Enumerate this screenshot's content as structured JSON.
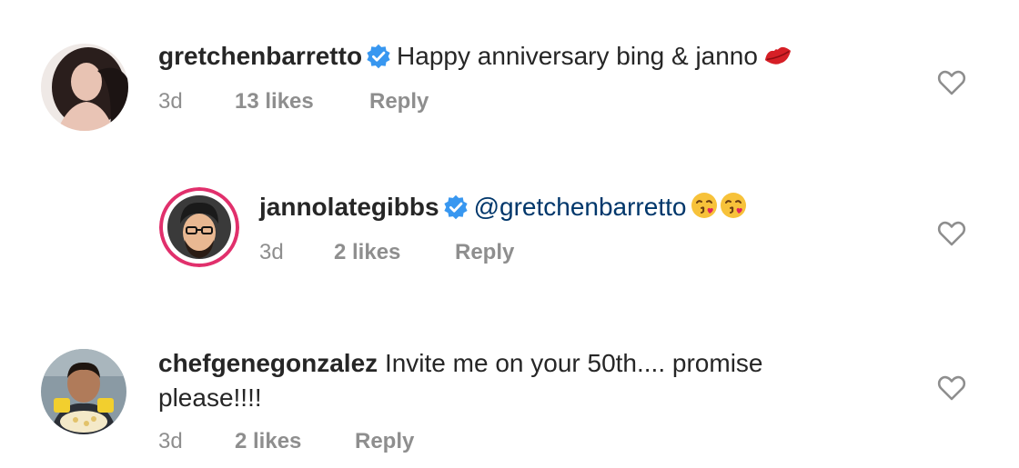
{
  "comments": [
    {
      "username": "gretchenbarretto",
      "verified": true,
      "text": "Happy anniversary bing & janno",
      "emoji": [
        "kiss-mark-icon"
      ],
      "time": "3d",
      "likes": "13 likes",
      "reply": "Reply"
    },
    {
      "username": "jannolategibbs",
      "verified": true,
      "mention": "@gretchenbarretto",
      "emoji": [
        "face-blowing-kiss-icon",
        "face-blowing-kiss-icon"
      ],
      "time": "3d",
      "likes": "2 likes",
      "reply": "Reply",
      "is_reply": true
    },
    {
      "username": "chefgenegonzalez",
      "verified": false,
      "text": "Invite me on your 50th.... promise please!!!!",
      "time": "3d",
      "likes": "2 likes",
      "reply": "Reply"
    }
  ],
  "colors": {
    "text": "#262626",
    "muted": "#8e8e8e",
    "verified_blue": "#3897f0",
    "mention": "#00376b",
    "story_ring": "#e1306c"
  }
}
